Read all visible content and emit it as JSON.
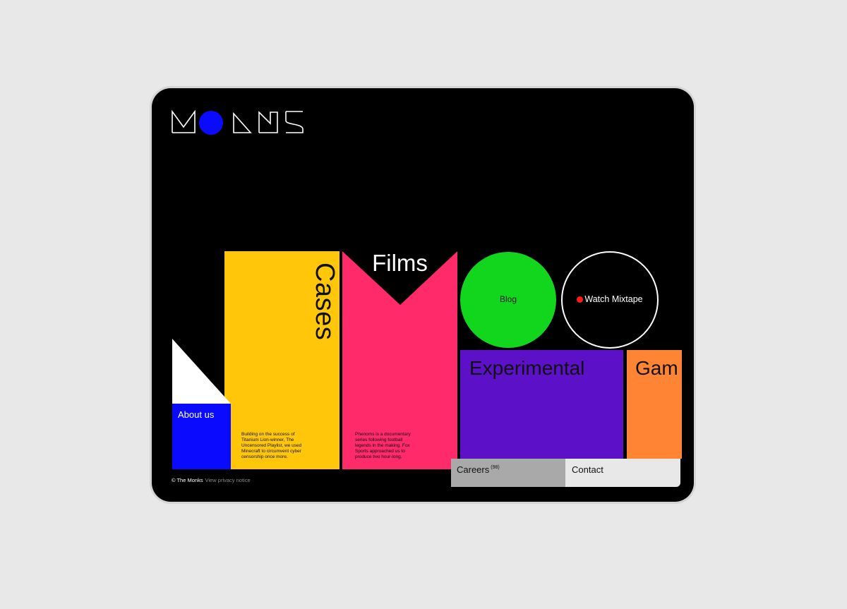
{
  "brand": {
    "logo_text": "MONKS",
    "accent_blue": "#0a0aff"
  },
  "tiles": {
    "cases": {
      "title": "Cases",
      "description": "Building on the success of Titanium Lion-winner, The Uncensored Playlist, we used Minecraft to circumvent cyber censorship once more.",
      "color": "#ffc60a"
    },
    "films": {
      "title": "Films",
      "description": "Phenoms is a documentary series following football legends in the making. Fox Sports approached us to produce two hour-long.",
      "color": "#ff2a6a"
    },
    "blog": {
      "label": "Blog",
      "color": "#11d61d"
    },
    "mixtape": {
      "label": "Watch Mixtape",
      "icon": "record-dot-icon",
      "dot_color": "#ff1a1a"
    },
    "experimental": {
      "title": "Experimental",
      "color": "#5c11c8"
    },
    "games": {
      "title": "Gam",
      "color": "#ff8535"
    },
    "about": {
      "label": "About us",
      "color": "#0a0aff"
    }
  },
  "footer": {
    "copyright": "© The Monks",
    "privacy_link": "View privacy notice"
  },
  "bottom_nav": {
    "careers_label": "Careers",
    "careers_count": "(98)",
    "contact_label": "Contact"
  }
}
